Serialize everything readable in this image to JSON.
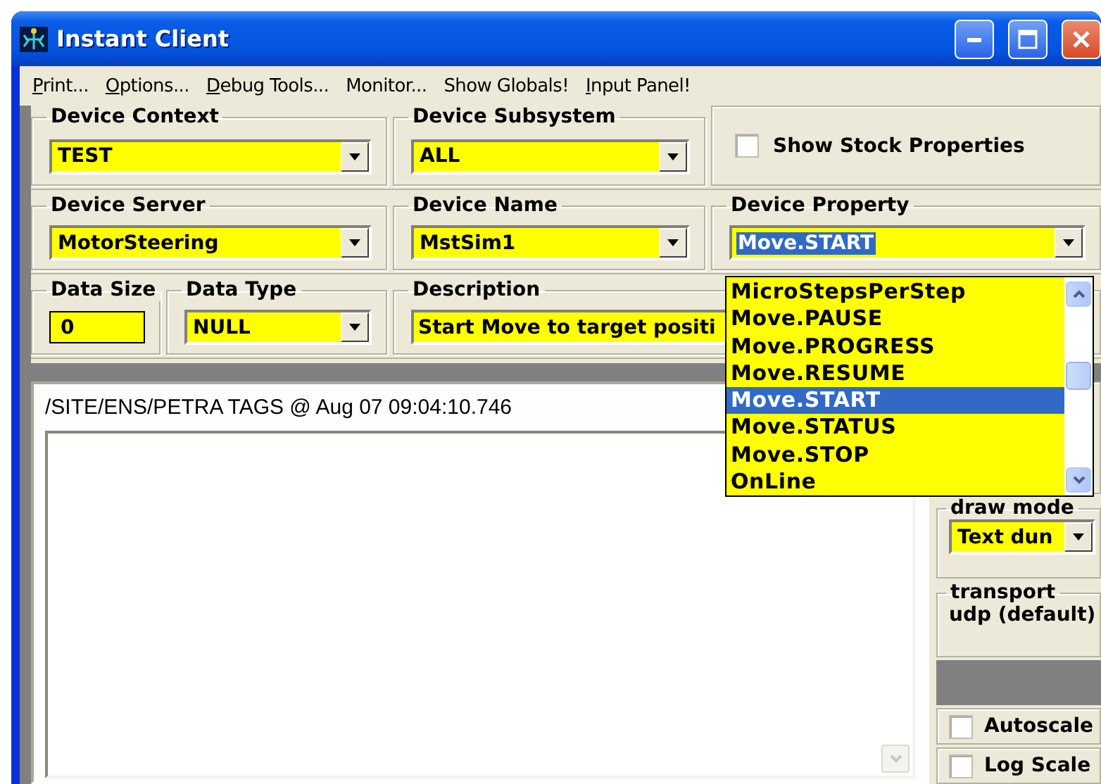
{
  "window": {
    "title": "Instant Client"
  },
  "menu": [
    {
      "label": "Print...",
      "underline_first": true
    },
    {
      "label": "Options...",
      "underline_first": true
    },
    {
      "label": "Debug Tools...",
      "underline_first": true
    },
    {
      "label": "Monitor...",
      "underline_first": false
    },
    {
      "label": "Show Globals!",
      "underline_first": false
    },
    {
      "label": "Input Panel!",
      "underline_first": true
    }
  ],
  "device_context": {
    "label": "Device Context",
    "value": "TEST"
  },
  "device_subsystem": {
    "label": "Device Subsystem",
    "value": "ALL"
  },
  "show_stock_properties": {
    "label": "Show Stock Properties",
    "checked": false
  },
  "device_server": {
    "label": "Device Server",
    "value": "MotorSteering"
  },
  "device_name": {
    "label": "Device Name",
    "value": "MstSim1"
  },
  "device_property": {
    "label": "Device Property",
    "value": "Move.START",
    "expanded": true,
    "options": [
      {
        "label": "MicroStepsPerStep",
        "selected": false
      },
      {
        "label": "Move.PAUSE",
        "selected": false
      },
      {
        "label": "Move.PROGRESS",
        "selected": false
      },
      {
        "label": "Move.RESUME",
        "selected": false
      },
      {
        "label": "Move.START",
        "selected": true
      },
      {
        "label": "Move.STATUS",
        "selected": false
      },
      {
        "label": "Move.STOP",
        "selected": false
      },
      {
        "label": "OnLine",
        "selected": false
      }
    ]
  },
  "data_size": {
    "label": "Data Size",
    "value": "0"
  },
  "data_type": {
    "label": "Data Type",
    "value": "NULL"
  },
  "description": {
    "label": "Description",
    "value": "Start Move to target positi"
  },
  "output": {
    "header": "/SITE/ENS/PETRA TAGS @ Aug 07 09:04:10.746"
  },
  "draw_mode": {
    "label": "draw mode",
    "value": "Text dun"
  },
  "transport": {
    "label": "transport",
    "value": "udp (default)"
  },
  "plot_options": [
    {
      "label": "Autoscale",
      "checked": false
    },
    {
      "label": "Log Scale",
      "checked": false
    }
  ]
}
